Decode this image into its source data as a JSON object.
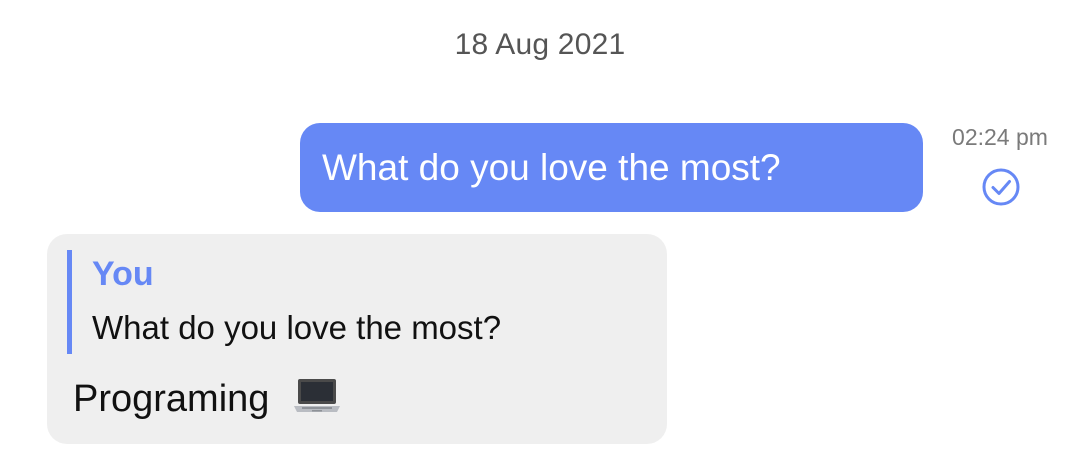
{
  "date_separator": "18 Aug 2021",
  "outgoing_message": {
    "text": "What do you love the most?",
    "time": "02:24 pm",
    "status_icon": "read-check-icon",
    "bubble_color": "#6688f5"
  },
  "incoming_message": {
    "quote": {
      "author": "You",
      "text": "What do you love the most?"
    },
    "text": "Programing",
    "emoji_icon": "laptop-icon",
    "bubble_color": "#efefef"
  },
  "colors": {
    "accent": "#6688f5",
    "meta_text": "#7a7a7a"
  }
}
